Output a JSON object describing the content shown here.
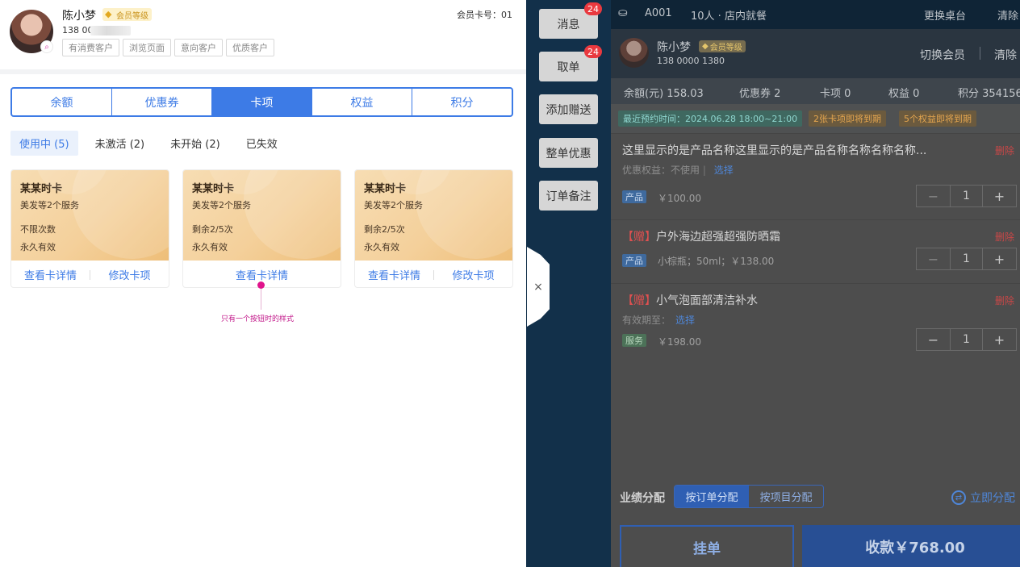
{
  "member_panel": {
    "name": "陈小梦",
    "level": "会员等级",
    "phone": "138 00",
    "card_no": "会员卡号：01",
    "tags": [
      "有消费客户",
      "浏览页面",
      "意向客户",
      "优质客户"
    ],
    "segments": [
      "余额",
      "优惠券",
      "卡项",
      "权益",
      "积分"
    ],
    "active_segment": "卡项",
    "status_tabs": [
      "使用中 (5)",
      "未激活 (2)",
      "未开始 (2)",
      "已失效"
    ],
    "cards": [
      {
        "title": "某某时卡",
        "desc": "美发等2个服务",
        "remaining": "不限次数",
        "validity": "永久有效",
        "btn_detail": "查看卡详情",
        "btn_edit": "修改卡项"
      },
      {
        "title": "某某时卡",
        "desc": "美发等2个服务",
        "remaining": "剩余2/5次",
        "validity": "永久有效",
        "btn_detail": "查看卡详情"
      },
      {
        "title": "某某时卡",
        "desc": "美发等2个服务",
        "remaining": "剩余2/5次",
        "validity": "永久有效",
        "btn_detail": "查看卡详情",
        "btn_edit": "修改卡项"
      }
    ],
    "annotation": "只有一个按钮时的样式"
  },
  "drawer": {
    "close_glyph": "×"
  },
  "side_buttons": [
    {
      "label": "消息",
      "badge": "24"
    },
    {
      "label": "取单",
      "badge": "24"
    },
    {
      "label": "添加赠送"
    },
    {
      "label": "整单优惠"
    },
    {
      "label": "订单备注"
    }
  ],
  "order": {
    "topbar": {
      "table": "A001",
      "guests": "10人 · 店内就餐",
      "change_table": "更换桌台",
      "clear": "清除"
    },
    "member": {
      "name": "陈小梦",
      "level": "会员等级",
      "phone": "138 0000 1380",
      "switch": "切换会员",
      "clear": "清除"
    },
    "stats": [
      "余額(元) 158.03",
      "优惠券 2",
      "卡项 0",
      "权益 0",
      "积分 354156"
    ],
    "notices": {
      "time": "最近预约时间：2024.06.28 18:00~21:00",
      "warn_cards": "2张卡项即将到期",
      "warn_rights": "5个权益即将到期"
    },
    "items": [
      {
        "gift": "",
        "name": "这里显示的是产品名称这里显示的是产品名称名称名称名称...",
        "delete": "删除",
        "sub_label": "优惠权益：不使用",
        "sub_link": "选择",
        "tag": "产品",
        "price": "￥100.00",
        "qty": "1"
      },
      {
        "gift": "【赠】",
        "name": "户外海边超强超强防晒霜",
        "delete": "删除",
        "tag": "产品",
        "price": "小棕瓶；50ml；￥138.00",
        "qty": "1"
      },
      {
        "gift": "【赠】",
        "name": "小气泡面部清洁补水",
        "delete": "删除",
        "sub_label": "有效期至：",
        "sub_link": "选择",
        "tag": "服务",
        "price": "￥198.00",
        "qty": "1"
      }
    ],
    "performance": {
      "label": "业绩分配",
      "by_order": "按订单分配",
      "by_item": "按项目分配",
      "assign_now": "立即分配"
    },
    "hang_label": "挂单",
    "pay_label": "收款￥768.00"
  },
  "colors": {
    "accent": "#3d7be6",
    "dark_panel": "#12304a",
    "gold_card": "#f4d09b",
    "delete_red": "#c84848"
  }
}
